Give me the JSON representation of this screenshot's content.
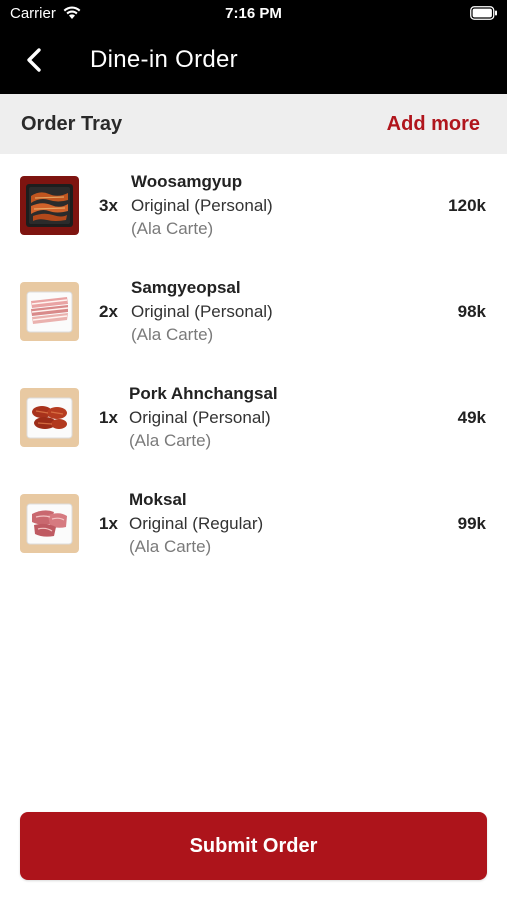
{
  "status_bar": {
    "carrier": "Carrier",
    "time": "7:16 PM"
  },
  "header": {
    "title": "Dine-in Order"
  },
  "tray": {
    "title": "Order Tray",
    "add_more_label": "Add more"
  },
  "items": [
    {
      "name": "Woosamgyup",
      "qty": "3x",
      "variant": "Original (Personal)",
      "type": "(Ala Carte)",
      "price": "120k",
      "thumb_icon": "grilled-meat-black-tray-icon"
    },
    {
      "name": "Samgyeopsal",
      "qty": "2x",
      "variant": "Original (Personal)",
      "type": "(Ala Carte)",
      "price": "98k",
      "thumb_icon": "pork-belly-tray-icon"
    },
    {
      "name": "Pork Ahnchangsal",
      "qty": "1x",
      "variant": "Original (Personal)",
      "type": "(Ala Carte)",
      "price": "49k",
      "thumb_icon": "marinated-pork-tray-icon"
    },
    {
      "name": "Moksal",
      "qty": "1x",
      "variant": "Original (Regular)",
      "type": "(Ala Carte)",
      "price": "99k",
      "thumb_icon": "pork-neck-tray-icon"
    }
  ],
  "submit": {
    "label": "Submit Order"
  },
  "colors": {
    "accent": "#ad141b",
    "header_bg": "#000000",
    "tray_bar_bg": "#eeeeee"
  }
}
